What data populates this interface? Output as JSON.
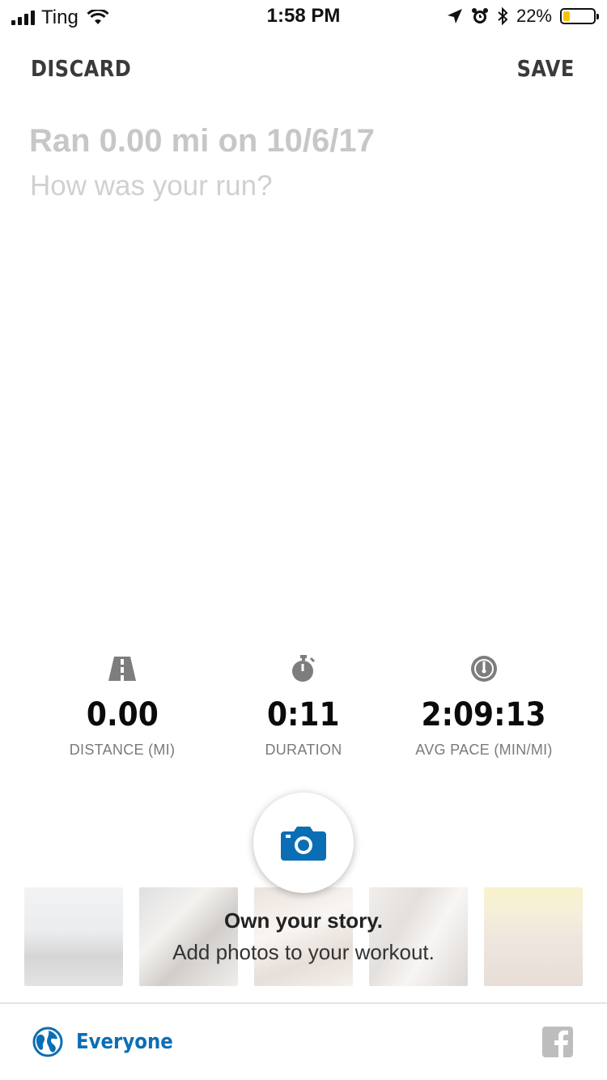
{
  "status_bar": {
    "carrier": "Ting",
    "time": "1:58 PM",
    "battery_percent": "22%",
    "battery_level": 0.22,
    "battery_color": "#f5c400",
    "icons": [
      "signal-icon",
      "wifi-icon",
      "location-icon",
      "alarm-icon",
      "bluetooth-icon",
      "battery-icon"
    ]
  },
  "header": {
    "discard_label": "DISCARD",
    "save_label": "SAVE"
  },
  "post": {
    "title_placeholder": "Ran 0.00 mi on 10/6/17",
    "body_placeholder": "How was your run?"
  },
  "stats": [
    {
      "icon": "road-icon",
      "value": "0.00",
      "label": "DISTANCE (MI)"
    },
    {
      "icon": "stopwatch-icon",
      "value": "0:11",
      "label": "DURATION"
    },
    {
      "icon": "speedometer-icon",
      "value": "2:09:13",
      "label": "AVG PACE (MIN/MI)"
    }
  ],
  "photos": {
    "headline": "Own your story.",
    "subline": "Add photos to your workout.",
    "camera_icon": "camera-icon",
    "thumb_count": 5
  },
  "footer": {
    "privacy_label": "Everyone",
    "privacy_icon": "globe-icon",
    "share_icon": "facebook-icon",
    "accent": "#0b6eb5"
  }
}
